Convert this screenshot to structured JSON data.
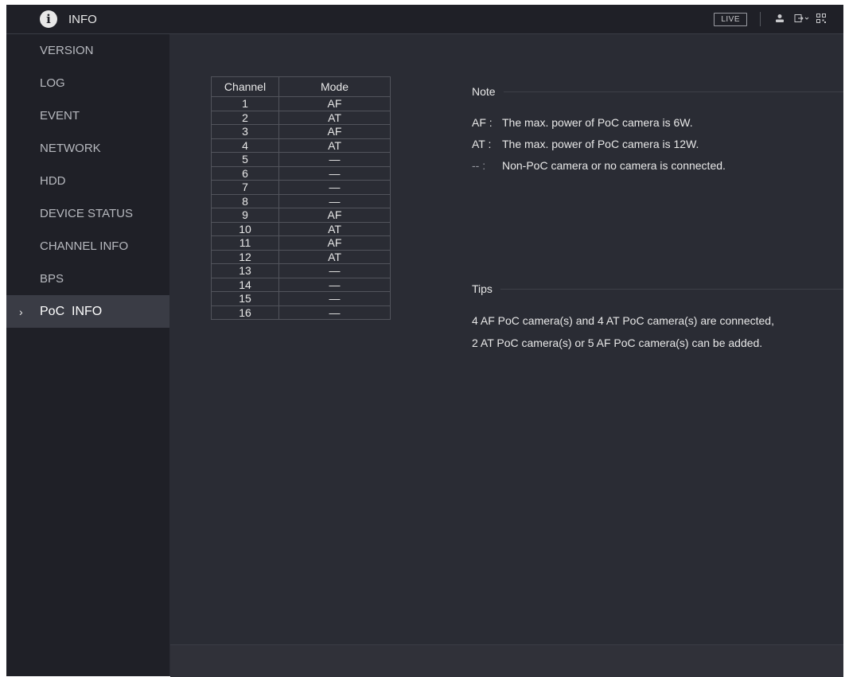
{
  "header": {
    "title": "INFO",
    "live_label": "LIVE",
    "icons": [
      "user-icon",
      "logout-icon",
      "qr-code-icon"
    ]
  },
  "sidebar": {
    "items": [
      {
        "label": "VERSION"
      },
      {
        "label": "LOG"
      },
      {
        "label": "EVENT"
      },
      {
        "label": "NETWORK"
      },
      {
        "label": "HDD"
      },
      {
        "label": "DEVICE STATUS"
      },
      {
        "label": "CHANNEL INFO"
      },
      {
        "label": "BPS"
      },
      {
        "label": "PoC  INFO",
        "active": true
      }
    ]
  },
  "table": {
    "headers": [
      "Channel",
      "Mode"
    ],
    "rows": [
      [
        "1",
        "AF"
      ],
      [
        "2",
        "AT"
      ],
      [
        "3",
        "AF"
      ],
      [
        "4",
        "AT"
      ],
      [
        "5",
        "—"
      ],
      [
        "6",
        "—"
      ],
      [
        "7",
        "—"
      ],
      [
        "8",
        "—"
      ],
      [
        "9",
        "AF"
      ],
      [
        "10",
        "AT"
      ],
      [
        "11",
        "AF"
      ],
      [
        "12",
        "AT"
      ],
      [
        "13",
        "—"
      ],
      [
        "14",
        "—"
      ],
      [
        "15",
        "—"
      ],
      [
        "16",
        "—"
      ]
    ]
  },
  "note": {
    "title": "Note",
    "items": [
      {
        "key": "AF :",
        "text": "The max. power of PoC camera is 6W."
      },
      {
        "key": "AT :",
        "text": "The max. power of PoC camera is 12W."
      },
      {
        "key": "-- :",
        "text": "Non-PoC camera or no camera is connected."
      }
    ]
  },
  "tips": {
    "title": "Tips",
    "lines": [
      "4 AF PoC camera(s) and 4 AT PoC camera(s) are connected,",
      "2 AT PoC camera(s) or 5 AF PoC camera(s) can be added."
    ]
  },
  "colors": {
    "background": "#2a2c34",
    "sidebar": "#1f2027",
    "active_item": "#3a3c45",
    "text": "#e8e8e8"
  }
}
